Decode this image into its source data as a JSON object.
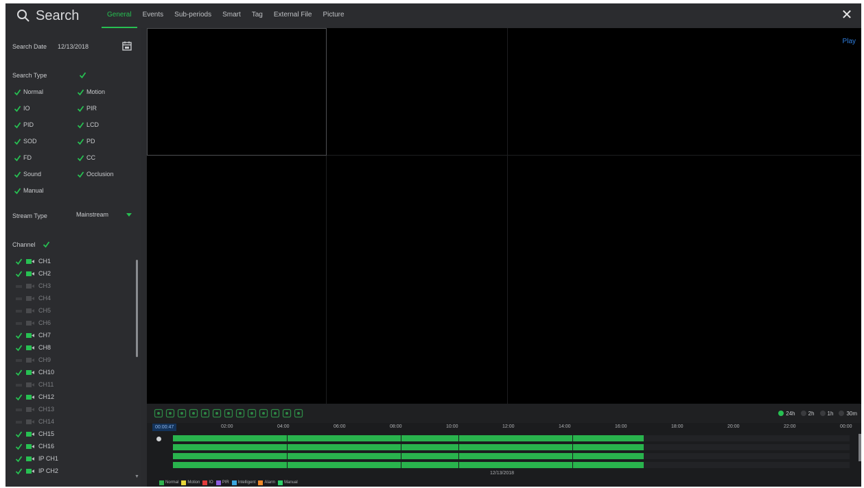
{
  "header": {
    "title": "Search",
    "tabs": [
      {
        "label": "General",
        "active": true
      },
      {
        "label": "Events",
        "active": false
      },
      {
        "label": "Sub-periods",
        "active": false
      },
      {
        "label": "Smart",
        "active": false
      },
      {
        "label": "Tag",
        "active": false
      },
      {
        "label": "External File",
        "active": false
      },
      {
        "label": "Picture",
        "active": false
      }
    ],
    "close_icon": "close-icon"
  },
  "sidebar": {
    "search_date_label": "Search Date",
    "search_date_value": "12/13/2018",
    "search_type_label": "Search Type",
    "search_types": [
      {
        "label": "Normal",
        "checked": true
      },
      {
        "label": "Motion",
        "checked": true
      },
      {
        "label": "IO",
        "checked": true
      },
      {
        "label": "PIR",
        "checked": true
      },
      {
        "label": "PID",
        "checked": true
      },
      {
        "label": "LCD",
        "checked": true
      },
      {
        "label": "SOD",
        "checked": true
      },
      {
        "label": "PD",
        "checked": true
      },
      {
        "label": "FD",
        "checked": true
      },
      {
        "label": "CC",
        "checked": true
      },
      {
        "label": "Sound",
        "checked": true
      },
      {
        "label": "Occlusion",
        "checked": true
      },
      {
        "label": "Manual",
        "checked": true
      }
    ],
    "stream_type_label": "Stream Type",
    "stream_type_value": "Mainstream",
    "channel_label": "Channel",
    "channels": [
      {
        "label": "CH1",
        "checked": true
      },
      {
        "label": "CH2",
        "checked": true
      },
      {
        "label": "CH3",
        "checked": false
      },
      {
        "label": "CH4",
        "checked": false
      },
      {
        "label": "CH5",
        "checked": false
      },
      {
        "label": "CH6",
        "checked": false
      },
      {
        "label": "CH7",
        "checked": true
      },
      {
        "label": "CH8",
        "checked": true
      },
      {
        "label": "CH9",
        "checked": false
      },
      {
        "label": "CH10",
        "checked": true
      },
      {
        "label": "CH11",
        "checked": false
      },
      {
        "label": "CH12",
        "checked": true
      },
      {
        "label": "CH13",
        "checked": false
      },
      {
        "label": "CH14",
        "checked": false
      },
      {
        "label": "CH15",
        "checked": true
      },
      {
        "label": "CH16",
        "checked": true
      },
      {
        "label": "IP CH1",
        "checked": true
      },
      {
        "label": "IP CH2",
        "checked": true
      }
    ]
  },
  "video": {
    "play_label": "Play"
  },
  "toolbar": {
    "icons": [
      "fullscreen-icon",
      "split-icon",
      "split4-icon",
      "trash-icon",
      "clip-icon",
      "stop-icon",
      "frame-icon",
      "zoom-in-icon",
      "crop-icon",
      "volume-icon",
      "snapshot-icon",
      "zoom-icon",
      "settings-icon"
    ],
    "zoom_options": [
      {
        "label": "24h",
        "selected": true
      },
      {
        "label": "2h",
        "selected": false
      },
      {
        "label": "1h",
        "selected": false
      },
      {
        "label": "30m",
        "selected": false
      }
    ]
  },
  "timeline": {
    "selected_time": "00:00:47",
    "ticks": [
      "02:00",
      "04:00",
      "06:00",
      "08:00",
      "10:00",
      "12:00",
      "14:00",
      "16:00",
      "18:00",
      "20:00",
      "22:00",
      "00:00"
    ],
    "date_label": "12/13/2018",
    "legend": [
      {
        "label": "Normal",
        "color": "#2fb34f"
      },
      {
        "label": "Motion",
        "color": "#e8d73a"
      },
      {
        "label": "IO",
        "color": "#e23b3b"
      },
      {
        "label": "PIR",
        "color": "#8d5ce0"
      },
      {
        "label": "Intelligent",
        "color": "#3ba7e0"
      },
      {
        "label": "Alarm",
        "color": "#f08a2a"
      },
      {
        "label": "Manual",
        "color": "#2fd06a"
      }
    ]
  },
  "colors": {
    "accent": "#27c052",
    "record_bar": "#29b34d",
    "play": "#2f7fe0"
  }
}
